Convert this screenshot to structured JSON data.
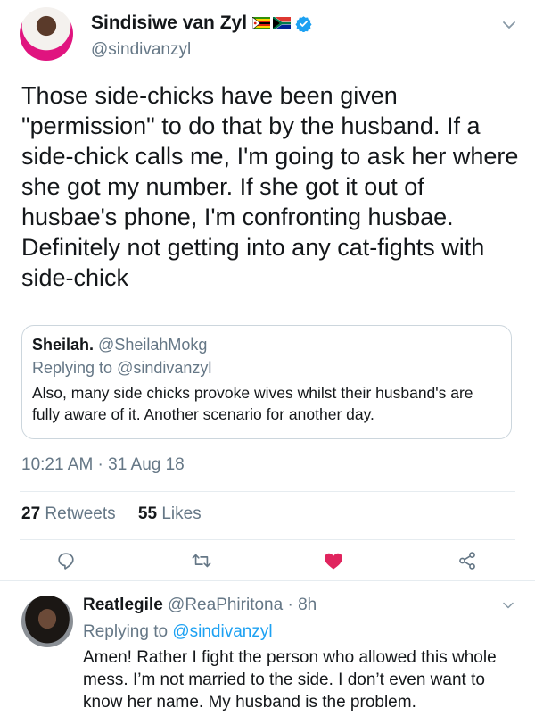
{
  "tweet": {
    "author_name": "Sindisiwe van Zyl",
    "author_handle": "@sindivanzyl",
    "text": "Those side-chicks have been given \"permission\" to do that by the husband. If a side-chick calls me, I'm going to ask her where she got my number. If she got it out of husbae's phone, I'm confronting husbae. Definitely not getting into any cat-fights with side-chick",
    "quoted": {
      "author_name": "Sheilah.",
      "author_handle": "@SheilahMokg",
      "replying_label": "Replying to ",
      "replying_handle": "@sindivanzyl",
      "text": "Also, many side chicks provoke wives whilst their husband's are fully aware of it. Another scenario for another day."
    },
    "timestamp": "10:21 AM · 31 Aug 18",
    "retweets_count": "27",
    "retweets_label": "Retweets",
    "likes_count": "55",
    "likes_label": "Likes"
  },
  "reply": {
    "author_name": "Reatlegile",
    "author_handle": "@ReaPhiritona",
    "time": "· 8h",
    "replying_label": "Replying to ",
    "replying_handle": "@sindivanzyl",
    "text": "Amen! Rather I fight the person who allowed this whole mess. I’m not married to the side. I don’t even want to know her name. My husband is the problem."
  },
  "colors": {
    "accent": "#1da1f2",
    "like": "#e0245e",
    "verified": "#1da1f2",
    "muted": "#657786"
  },
  "icons": {
    "menu": "chevron-down-icon",
    "verified": "verified-badge-icon",
    "flags": "flag-icons",
    "reply": "reply-icon",
    "retweet": "retweet-icon",
    "like": "heart-icon",
    "share": "share-icon"
  }
}
